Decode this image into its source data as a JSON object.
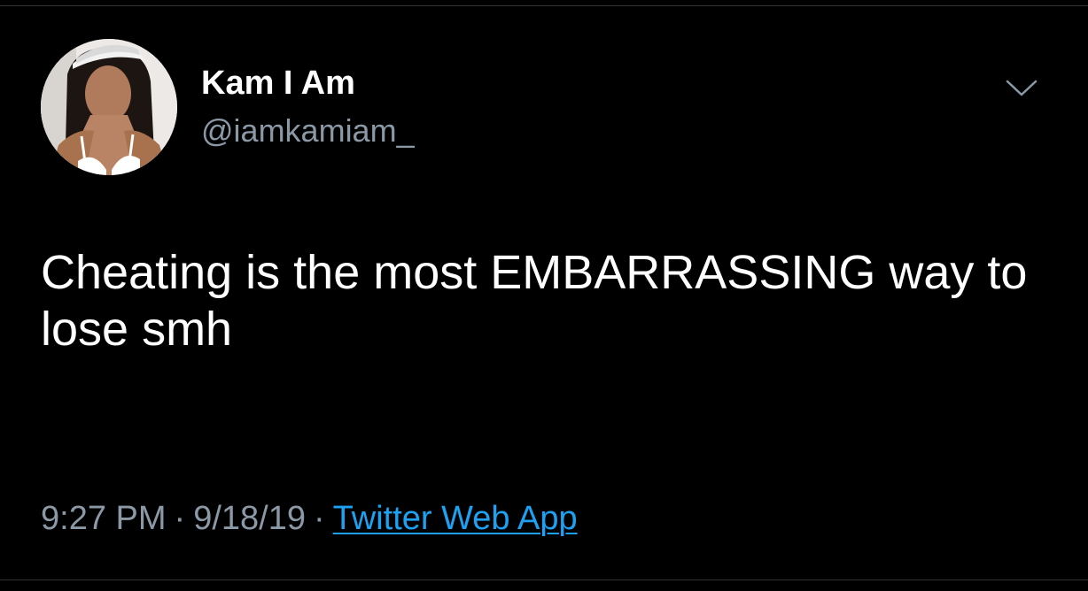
{
  "tweet": {
    "author": {
      "display_name": "Kam I Am",
      "handle": "@iamkamiam_",
      "avatar_icon": "profile-photo"
    },
    "menu_icon": "chevron-down-icon",
    "text": "Cheating is the most EMBARRASSING way to lose smh",
    "time": "9:27 PM",
    "date": "9/18/19",
    "separator": "·",
    "source": "Twitter Web App"
  },
  "colors": {
    "background": "#000000",
    "primary_text": "#ffffff",
    "secondary_text": "#8b98a5",
    "link": "#1da1f2",
    "divider": "#2f3336"
  }
}
